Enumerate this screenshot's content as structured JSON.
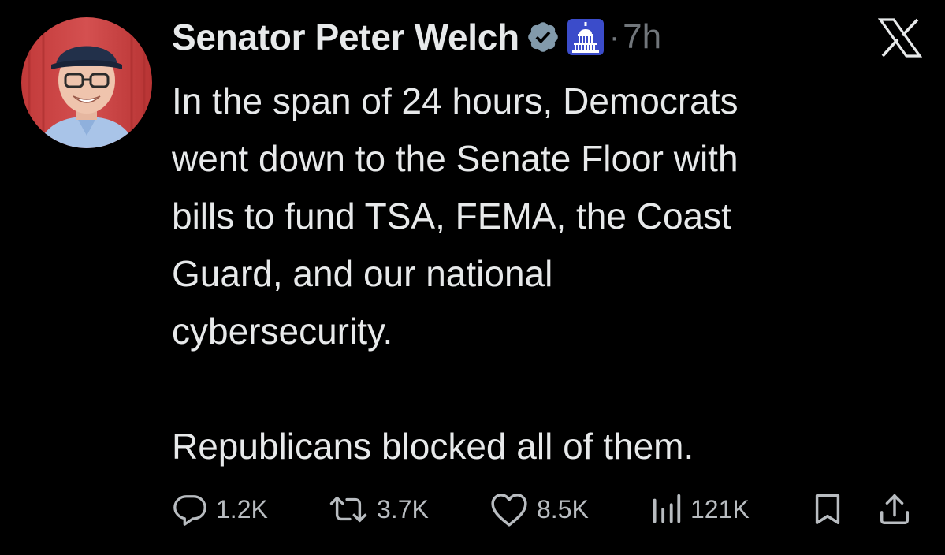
{
  "author": {
    "name": "Senator Peter Welch",
    "verified_icon": "verified-badge-icon",
    "affiliation_icon": "capitol-dome-icon",
    "separator": "·",
    "time": "7h"
  },
  "platform_icon": "x-logo-icon",
  "post": {
    "text": "In the span of 24 hours, Democrats\nwent down to the Senate Floor with\nbills to fund TSA, FEMA, the Coast\nGuard, and our national\ncybersecurity.\n\nRepublicans blocked all of them."
  },
  "actions": {
    "replies": "1.2K",
    "reposts": "3.7K",
    "likes": "8.5K",
    "views": "121K"
  },
  "colors": {
    "background": "#000000",
    "text": "#e7e9ea",
    "muted": "#71767b",
    "verified": "#829aab",
    "affiliation": "#3b4cca"
  }
}
